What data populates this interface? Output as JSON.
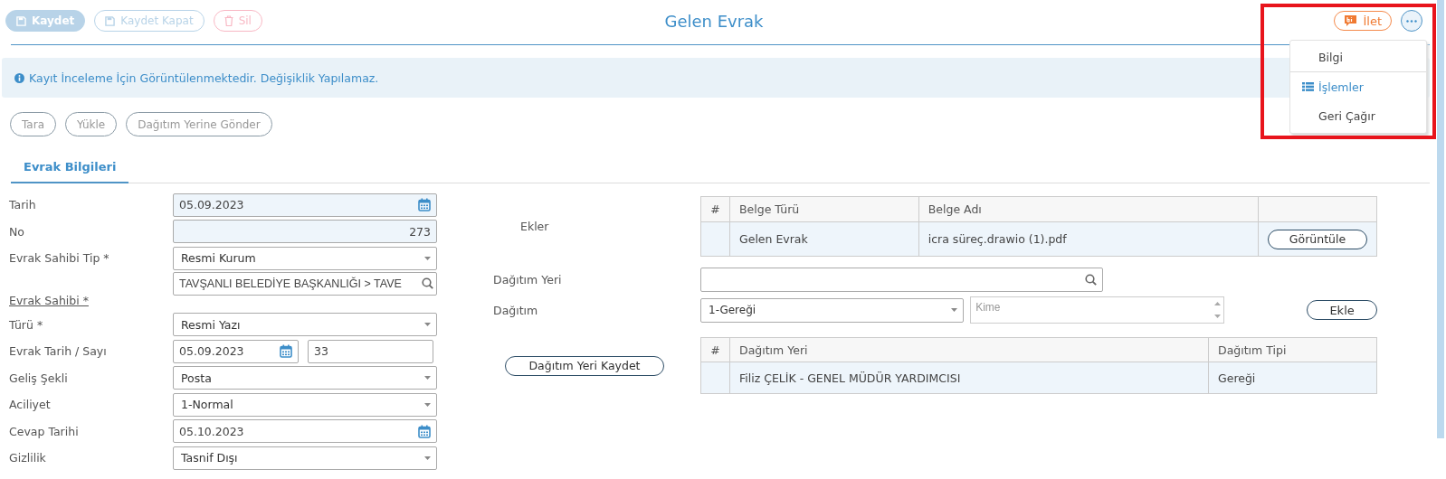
{
  "toolbar": {
    "buttons": [
      {
        "label": "Kaydet",
        "kind": "primary",
        "disabled": true
      },
      {
        "label": "Kaydet Kapat",
        "kind": "outline",
        "disabled": true
      },
      {
        "label": "Sil",
        "kind": "danger",
        "disabled": true
      }
    ]
  },
  "title": "Gelen Evrak",
  "forward_button": {
    "label": "İlet"
  },
  "more_menu": {
    "expanded": true,
    "items": [
      {
        "label": "Bilgi",
        "selected": false
      },
      {
        "label": "İşlemler",
        "selected": true
      },
      {
        "label": "Geri Çağır",
        "selected": false
      }
    ]
  },
  "info_message": "Kayıt İnceleme İçin Görüntülenmektedir. Değişiklik Yapılamaz.",
  "action_buttons": [
    "Tara",
    "Yükle",
    "Dağıtım Yerine Gönder"
  ],
  "tabs": [
    {
      "label": "Evrak Bilgileri",
      "selected": true
    }
  ],
  "form": {
    "fields": [
      {
        "label": "Tarih",
        "kind": "date",
        "value": "05.09.2023",
        "readonly": true
      },
      {
        "label": "No",
        "kind": "number",
        "value": "273",
        "readonly": true
      },
      {
        "label": "Evrak Sahibi Tip *",
        "kind": "select",
        "value": "Resmi Kurum",
        "readonly": false
      },
      {
        "label": "Evrak Sahibi *",
        "kind": "lookup",
        "value": "TAVŞANLI BELEDİYE BAŞKANLIĞI > TAVE",
        "readonly": false
      },
      {
        "label": "Türü *",
        "kind": "select",
        "value": "Resmi Yazı",
        "readonly": false
      },
      {
        "label": "Evrak Tarih / Sayı",
        "kind": "date-number",
        "value": "05.09.2023",
        "value_2": "33",
        "readonly": false
      },
      {
        "label": "Geliş Şekli",
        "kind": "select",
        "value": "Posta",
        "readonly": false
      },
      {
        "label": "Aciliyet",
        "kind": "select",
        "value": "1-Normal",
        "readonly": false
      },
      {
        "label": "Cevap Tarihi",
        "kind": "date",
        "value": "05.10.2023",
        "readonly": false
      },
      {
        "label": "Gizlilik",
        "kind": "select",
        "value": "Tasnif Dışı",
        "readonly": false
      }
    ]
  },
  "attachments": {
    "label": "Ekler",
    "columns": [
      "#",
      "Belge Türü",
      "Belge Adı"
    ],
    "rows": [
      {
        "type": "Gelen Evrak",
        "name": "icra süreç.drawio (1).pdf",
        "action": "Görüntüle"
      }
    ]
  },
  "distribution": {
    "place_label": "Dağıtım Yeri",
    "type_label": "Dağıtım",
    "type_value": "1-Gereği",
    "recipient": {
      "placeholder": "Kime"
    },
    "add_button": "Ekle",
    "save_button": "Dağıtım Yeri Kaydet",
    "columns": [
      "#",
      "Dağıtım Yeri",
      "Dağıtım Tipi"
    ],
    "rows": [
      {
        "place": "Filiz ÇELİK - GENEL MÜDÜR YARDIMCISI",
        "type": "Gereği"
      }
    ]
  }
}
